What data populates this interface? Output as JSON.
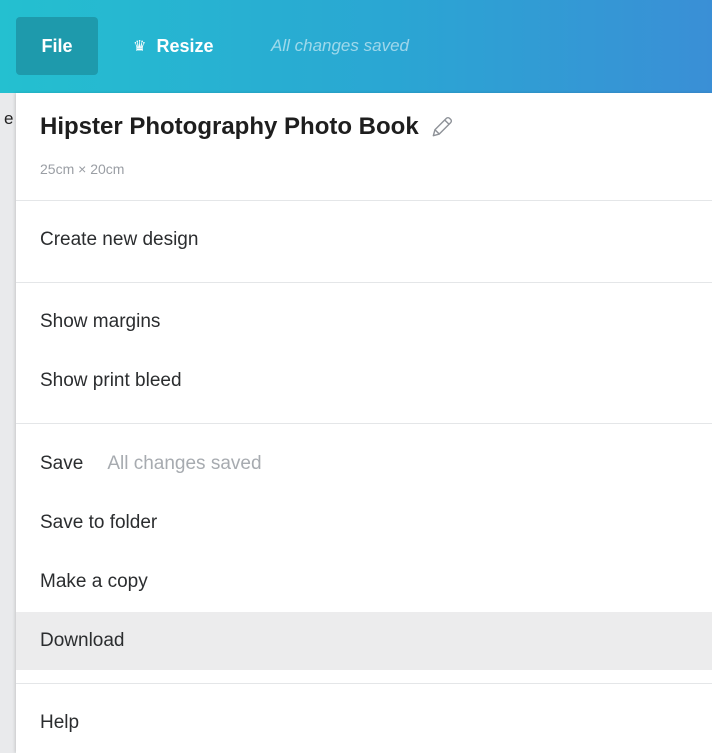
{
  "topbar": {
    "file_label": "File",
    "resize_label": "Resize",
    "resize_icon": "crown-icon",
    "autosave_status": "All changes saved"
  },
  "background": {
    "peek_text": "e"
  },
  "file_menu": {
    "design_title": "Hipster Photography Photo Book",
    "edit_icon": "pencil-icon",
    "design_size": "25cm × 20cm",
    "items": [
      {
        "label": "Create new design"
      },
      {
        "label": "Show margins"
      },
      {
        "label": "Show print bleed"
      },
      {
        "label": "Save",
        "note": "All changes saved"
      },
      {
        "label": "Save to folder"
      },
      {
        "label": "Make a copy"
      },
      {
        "label": "Download",
        "highlighted": true
      },
      {
        "label": "Help"
      }
    ]
  },
  "colors": {
    "topbar_gradient_start": "#24c0d0",
    "topbar_gradient_end": "#3a8fd6",
    "file_button_active": "#1e9aac",
    "hover_row": "#ececed"
  }
}
